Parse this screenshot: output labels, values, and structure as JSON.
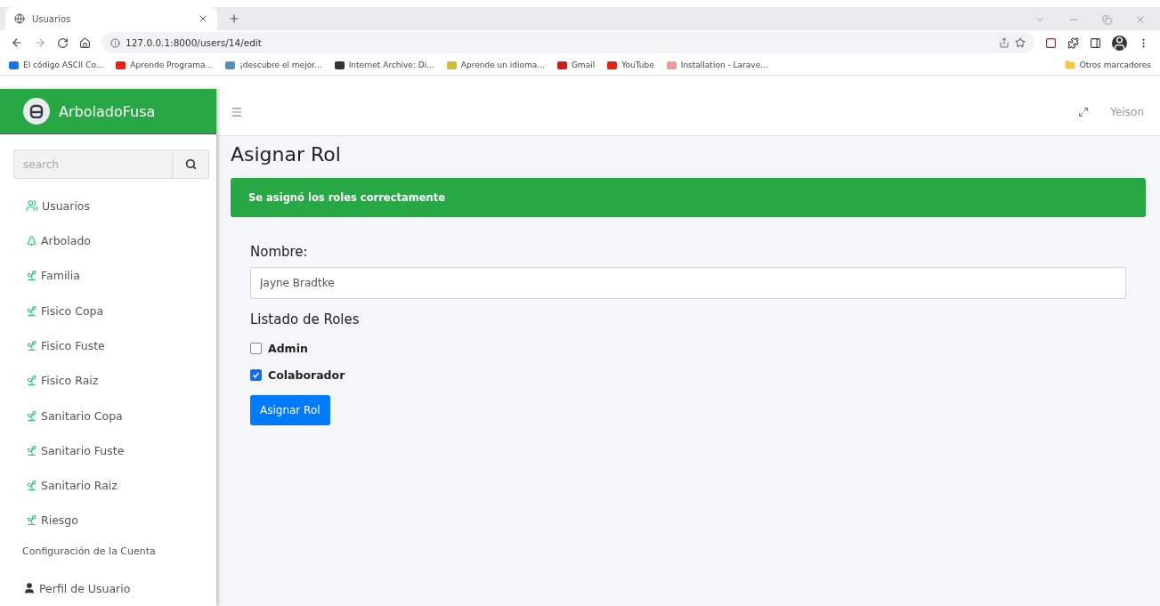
{
  "browser": {
    "tab": {
      "title": "Usuarios"
    },
    "url": "127.0.0.1:8000/users/14/edit",
    "bookmarks": [
      {
        "label": "El código ASCII Co...",
        "color": "#1a73e8"
      },
      {
        "label": "Aprende Programa...",
        "color": "#e62117"
      },
      {
        "label": "¡descubre el mejor...",
        "color": "#5a8fb5"
      },
      {
        "label": "Internet Archive: Di...",
        "color": "#333333"
      },
      {
        "label": "Aprende un idioma...",
        "color": "#d4b83a"
      },
      {
        "label": "Gmail",
        "color": "#c5221f"
      },
      {
        "label": "YouTube",
        "color": "#e62117"
      },
      {
        "label": "Installation - Larave...",
        "color": "#f19a9a"
      }
    ],
    "other_bookmarks": "Otros marcadores"
  },
  "sidebar": {
    "brand": "ArboladoFusa",
    "search": {
      "placeholder": "search"
    },
    "items": [
      {
        "label": "Usuarios",
        "kind": "users"
      },
      {
        "label": "Arbolado",
        "kind": "tree"
      },
      {
        "label": "Familia",
        "kind": "sprout"
      },
      {
        "label": "Fisico Copa",
        "kind": "sprout"
      },
      {
        "label": "Fisico Fuste",
        "kind": "sprout"
      },
      {
        "label": "Fisico Raiz",
        "kind": "sprout"
      },
      {
        "label": "Sanitario Copa",
        "kind": "sprout"
      },
      {
        "label": "Sanitario Fuste",
        "kind": "sprout"
      },
      {
        "label": "Sanitario Raiz",
        "kind": "sprout"
      },
      {
        "label": "Riesgo",
        "kind": "sprout"
      }
    ],
    "section": "Configuración de la Cuenta",
    "account_items": [
      {
        "label": "Perfil de Usuario",
        "kind": "user"
      }
    ]
  },
  "topbar": {
    "user": "Yeison"
  },
  "page": {
    "title": "Asignar Rol",
    "alert": "Se asignó los roles correctamente",
    "name_label": "Nombre:",
    "name_value": "Jayne Bradtke",
    "roles_heading": "Listado de Roles",
    "roles": [
      {
        "label": "Admin",
        "checked": false
      },
      {
        "label": "Colaborador",
        "checked": true
      }
    ],
    "button": "Asignar Rol"
  }
}
